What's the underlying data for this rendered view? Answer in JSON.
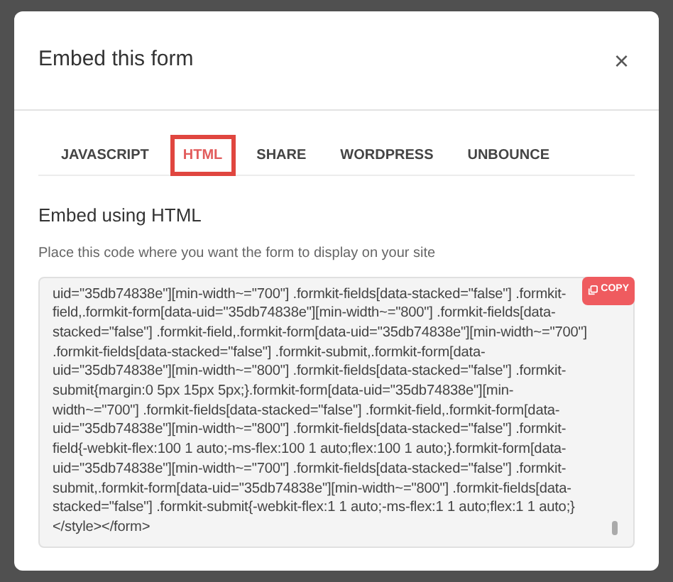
{
  "dialog": {
    "title": "Embed this form",
    "close": "×"
  },
  "tabs": [
    {
      "label": "JAVASCRIPT",
      "selected": false,
      "highlighted": false
    },
    {
      "label": "HTML",
      "selected": true,
      "highlighted": true
    },
    {
      "label": "SHARE",
      "selected": false,
      "highlighted": false
    },
    {
      "label": "WORDPRESS",
      "selected": false,
      "highlighted": false
    },
    {
      "label": "UNBOUNCE",
      "selected": false,
      "highlighted": false
    }
  ],
  "section": {
    "heading": "Embed using HTML",
    "description": "Place this code where you want the form to display on your site"
  },
  "code": {
    "copy_label": "COPY",
    "lines": [
      "uid=\"35db74838e\"][min-width~=\"700\"] .formkit-fields[data-stacked=\"false\"] .formkit-",
      "field,.formkit-form[data-uid=\"35db74838e\"][min-width~=\"800\"] .formkit-fields[data-",
      "stacked=\"false\"] .formkit-field,.formkit-form[data-uid=\"35db74838e\"][min-width~=\"700\"]",
      ".formkit-fields[data-stacked=\"false\"] .formkit-submit,.formkit-form[data-",
      "uid=\"35db74838e\"][min-width~=\"800\"] .formkit-fields[data-stacked=\"false\"] .formkit-",
      "submit{margin:0 5px 15px 5px;}.formkit-form[data-uid=\"35db74838e\"][min-",
      "width~=\"700\"] .formkit-fields[data-stacked=\"false\"] .formkit-field,.formkit-form[data-",
      "uid=\"35db74838e\"][min-width~=\"800\"] .formkit-fields[data-stacked=\"false\"] .formkit-",
      "field{-webkit-flex:100 1 auto;-ms-flex:100 1 auto;flex:100 1 auto;}.formkit-form[data-",
      "uid=\"35db74838e\"][min-width~=\"700\"] .formkit-fields[data-stacked=\"false\"] .formkit-",
      "submit,.formkit-form[data-uid=\"35db74838e\"][min-width~=\"800\"] .formkit-fields[data-",
      "stacked=\"false\"] .formkit-submit{-webkit-flex:1 1 auto;-ms-flex:1 1 auto;flex:1 1 auto;}",
      "</style></form>"
    ]
  }
}
